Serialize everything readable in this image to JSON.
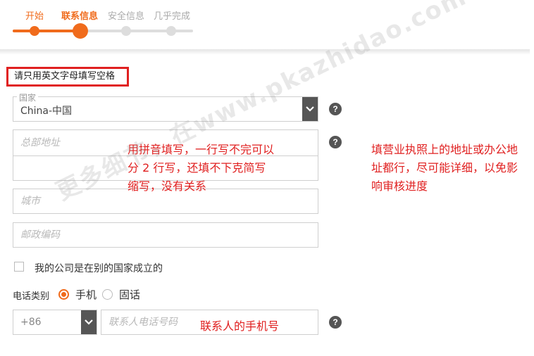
{
  "steps": [
    {
      "label": "开始",
      "state": "done"
    },
    {
      "label": "联系信息",
      "state": "current"
    },
    {
      "label": "安全信息",
      "state": "todo"
    },
    {
      "label": "几乎完成",
      "state": "todo"
    }
  ],
  "colors": {
    "accent": "#f06b1c",
    "annotation": "#e02020",
    "inactive": "#dddddd"
  },
  "hint": "请只用英文字母填写空格",
  "country": {
    "legend": "国家",
    "value": "China-中国",
    "help": "?"
  },
  "address": {
    "placeholder1": "总部地址",
    "placeholder2": "",
    "help": "?"
  },
  "city": {
    "placeholder": "城市"
  },
  "postal": {
    "placeholder": "邮政编码"
  },
  "foreign_company": {
    "label": "我的公司是在别的国家成立的"
  },
  "phone_type": {
    "label": "电话类别",
    "options": [
      "手机",
      "固话"
    ],
    "selected": "手机"
  },
  "phone": {
    "code": "+86",
    "placeholder": "联系人电话号码",
    "help": "?"
  },
  "annotations": {
    "address_tip": [
      "用拼音填写，一行写不完可以",
      "分 2 行写，还填不下克简写",
      "缩写，没有关系"
    ],
    "address_tip2": [
      "填营业执照上的地址或办公地",
      "址都行，尽可能详细，以免影",
      "响审核进度"
    ],
    "phone_tip": "联系人的手机号"
  },
  "watermark": "更多细节，在www.pkazhidao.com"
}
